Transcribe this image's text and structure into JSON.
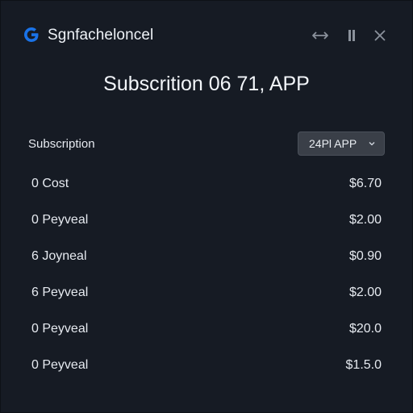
{
  "app": {
    "name": "Sgnfacheloncel",
    "logo_icon": "g-logo-icon",
    "logo_color": "#1a73e8"
  },
  "window_controls": {
    "resize_icon": "resize-icon",
    "pin_icon": "pin-icon",
    "close_icon": "close-icon"
  },
  "header": {
    "title": "Subscrition 06 71, APP"
  },
  "section": {
    "label": "Subscription",
    "plan_select": {
      "value": "24Pl APP",
      "caret_icon": "chevron-down-icon"
    }
  },
  "items": [
    {
      "label": "0 Cost",
      "price": "$6.70"
    },
    {
      "label": "0 Peyveal",
      "price": "$2.00"
    },
    {
      "label": "6 Joyneal",
      "price": "$0.90"
    },
    {
      "label": "6 Peyveal",
      "price": "$2.00"
    },
    {
      "label": "0 Peyveal",
      "price": "$20.0"
    },
    {
      "label": "0 Peyveal",
      "price": "$1.5.0"
    }
  ],
  "colors": {
    "window_bg": "#161b24",
    "text": "#e6eaf0",
    "select_bg": "#3a3f48",
    "icon_gray": "#8b929c"
  }
}
